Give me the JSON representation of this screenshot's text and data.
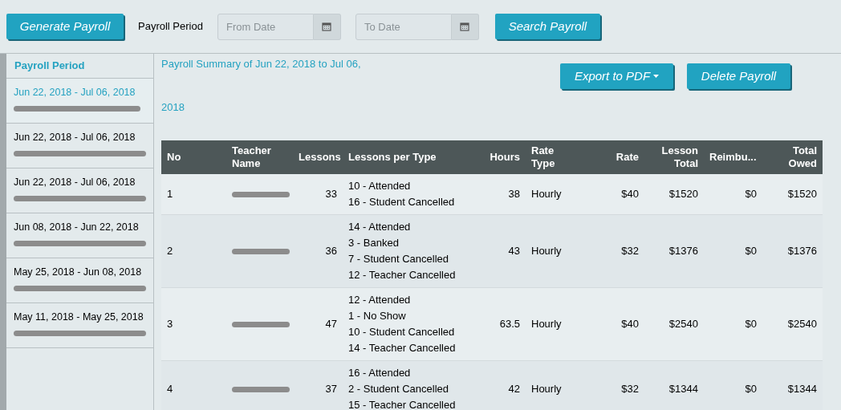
{
  "toolbar": {
    "generate_button": "Generate Payroll",
    "period_label": "Payroll Period",
    "from_date": {
      "placeholder": "From Date"
    },
    "to_date": {
      "placeholder": "To Date"
    },
    "search_button": "Search Payroll"
  },
  "sidebar": {
    "heading": "Payroll Period",
    "items": [
      {
        "period": "Jun 22, 2018 - Jul 06, 2018",
        "selected": true
      },
      {
        "period": "Jun 22, 2018 - Jul 06, 2018",
        "selected": false
      },
      {
        "period": "Jun 22, 2018 - Jul 06, 2018",
        "selected": false
      },
      {
        "period": "Jun 08, 2018 - Jun 22, 2018",
        "selected": false
      },
      {
        "period": "May 25, 2018 - Jun 08, 2018",
        "selected": false
      },
      {
        "period": "May 11, 2018 - May 25, 2018",
        "selected": false
      }
    ]
  },
  "summary": {
    "title": "Payroll Summary of Jun 22, 2018 to Jul 06, 2018",
    "export_button": "Export to PDF",
    "delete_button": "Delete Payroll"
  },
  "table": {
    "columns": [
      "No",
      "Teacher Name",
      "Lessons",
      "Lessons per Type",
      "Hours",
      "Rate Type",
      "Rate",
      "Lesson Total",
      "Reimbu...",
      "Total Owed"
    ],
    "rows": [
      {
        "no": "1",
        "lessons": "33",
        "types": [
          "10 - Attended",
          "16 - Student Cancelled"
        ],
        "hours": "38",
        "rate_type": "Hourly",
        "rate": "$40",
        "lesson_total": "$1520",
        "reimbursement": "$0",
        "total_owed": "$1520"
      },
      {
        "no": "2",
        "lessons": "36",
        "types": [
          "14 - Attended",
          "3 - Banked",
          "7 - Student Cancelled",
          "12 - Teacher Cancelled"
        ],
        "hours": "43",
        "rate_type": "Hourly",
        "rate": "$32",
        "lesson_total": "$1376",
        "reimbursement": "$0",
        "total_owed": "$1376"
      },
      {
        "no": "3",
        "lessons": "47",
        "types": [
          "12 - Attended",
          "1 - No Show",
          "10 - Student Cancelled",
          "14 - Teacher Cancelled"
        ],
        "hours": "63.5",
        "rate_type": "Hourly",
        "rate": "$40",
        "lesson_total": "$2540",
        "reimbursement": "$0",
        "total_owed": "$2540"
      },
      {
        "no": "4",
        "lessons": "37",
        "types": [
          "16 - Attended",
          "2 - Student Cancelled",
          "15 - Teacher Cancelled"
        ],
        "hours": "42",
        "rate_type": "Hourly",
        "rate": "$32",
        "lesson_total": "$1344",
        "reimbursement": "$0",
        "total_owed": "$1344"
      }
    ]
  }
}
